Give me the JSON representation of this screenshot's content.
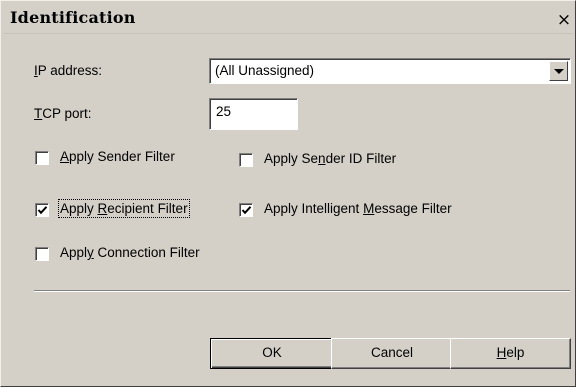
{
  "dialog": {
    "title": "Identification",
    "close_glyph": "×"
  },
  "ip": {
    "label_pre": "",
    "label_accel": "I",
    "label_post": "P address:",
    "value": "(All Unassigned)"
  },
  "tcp": {
    "label_accel": "T",
    "label_post": "CP port:",
    "value": "25"
  },
  "filters": {
    "sender": {
      "pre": "",
      "accel": "A",
      "post": "pply Sender Filter",
      "checked": false
    },
    "sender_id": {
      "pre": "Apply Se",
      "accel": "n",
      "post": "der ID Filter",
      "checked": false
    },
    "recipient": {
      "pre": "Apply ",
      "accel": "R",
      "post": "ecipient Filter",
      "checked": true
    },
    "intelligent": {
      "pre": "Apply Intelligent ",
      "accel": "M",
      "post": "essage Filter",
      "checked": true
    },
    "connection": {
      "pre": "Appl",
      "accel": "y",
      "post": " Connection Filter",
      "checked": false
    }
  },
  "buttons": {
    "ok": "OK",
    "cancel": "Cancel",
    "help_accel": "H",
    "help_post": "elp"
  }
}
